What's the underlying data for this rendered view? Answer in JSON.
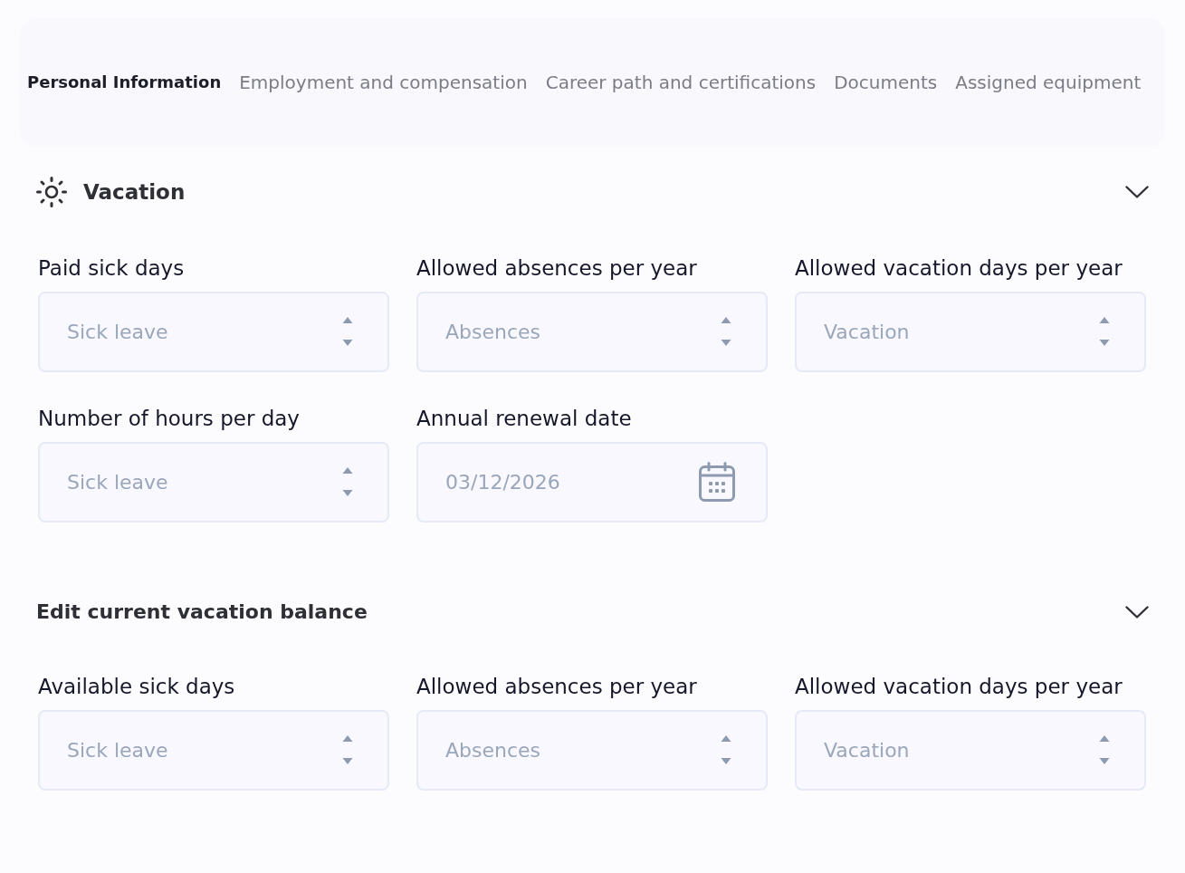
{
  "tabs": [
    {
      "label": "Personal Information",
      "selected": true
    },
    {
      "label": "Employment and compensation",
      "selected": false
    },
    {
      "label": "Career path and certifications",
      "selected": false
    },
    {
      "label": "Documents",
      "selected": false
    },
    {
      "label": "Assigned equipment",
      "selected": false
    }
  ],
  "sections": [
    {
      "kind": "main",
      "title": "Vacation",
      "expanded": true,
      "fields": [
        {
          "kind": "number",
          "label": "Paid sick days",
          "placeholder": "Sick leave"
        },
        {
          "kind": "number",
          "label": "Allowed absences per year",
          "placeholder": "Absences"
        },
        {
          "kind": "number",
          "label": "Allowed vacation days per year",
          "placeholder": "Vacation"
        },
        {
          "kind": "number",
          "label": "Number of hours per day",
          "placeholder": "Sick leave"
        },
        {
          "kind": "date",
          "label": "Annual renewal date",
          "value": "03/12/2026"
        }
      ]
    },
    {
      "kind": "sub",
      "title": "Edit current vacation balance",
      "expanded": true,
      "fields": [
        {
          "kind": "number",
          "label": "Available sick days",
          "placeholder": "Sick leave"
        },
        {
          "kind": "number",
          "label": "Allowed absences per year",
          "placeholder": "Absences"
        },
        {
          "kind": "number",
          "label": "Allowed vacation days per year",
          "placeholder": "Vacation"
        }
      ]
    }
  ]
}
